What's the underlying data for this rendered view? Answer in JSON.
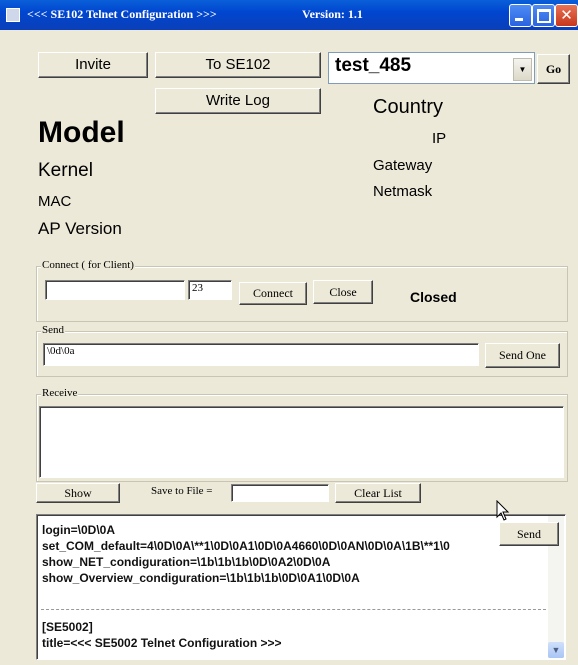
{
  "window": {
    "title": "<<< SE102 Telnet Configuration >>>",
    "version": "Version: 1.1",
    "close_glyph": "✕"
  },
  "toolbar": {
    "invite_label": "Invite",
    "to_se102_label": "To SE102",
    "write_log_label": "Write Log",
    "go_label": "Go"
  },
  "device_select": {
    "value": "test_485",
    "arrow": "▼"
  },
  "info": {
    "model": "Model",
    "kernel": "Kernel",
    "mac": "MAC",
    "ap_version": "AP Version",
    "country": "Country",
    "ip": "IP",
    "gateway": "Gateway",
    "netmask": "Netmask"
  },
  "connect": {
    "legend": "Connect ( for Client)",
    "host_value": "",
    "port_value": "23",
    "connect_label": "Connect",
    "close_label": "Close",
    "status": "Closed"
  },
  "send": {
    "legend": "Send",
    "value": "\\0d\\0a",
    "send_one_label": "Send One"
  },
  "receive": {
    "legend": "Receive"
  },
  "actions": {
    "show_label": "Show",
    "save_to_file_label": "Save to File =",
    "save_file_value": "",
    "clear_list_label": "Clear List",
    "send_label": "Send"
  },
  "script_list": {
    "lines": [
      "login=\\0D\\0A",
      "set_COM_default=4\\0D\\0A\\**1\\0D\\0A1\\0D\\0A4660\\0D\\0AN\\0D\\0A\\1B\\**1\\0",
      "show_NET_condiguration=\\1b\\1b\\1b\\0D\\0A2\\0D\\0A",
      "show_Overview_condiguration=\\1b\\1b\\1b\\0D\\0A1\\0D\\0A",
      "[SE5002]",
      "title=<<< SE5002 Telnet Configuration >>>"
    ],
    "scroll_arrow": "▼"
  }
}
